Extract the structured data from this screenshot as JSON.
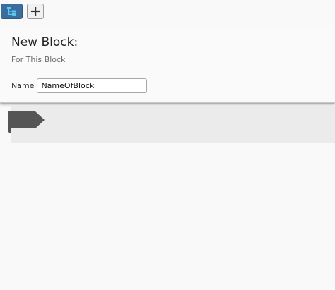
{
  "toolbar": {
    "tree_button_icon": "tree-structure-icon",
    "add_button_icon": "plus-icon",
    "tree_icon_color": "#5cc8f0",
    "tree_button_color": "#3a6e9c"
  },
  "panel": {
    "title": "New Block:",
    "subtitle": "For This Block",
    "name_label": "Name",
    "name_value": "NameOfBlock"
  },
  "canvas": {
    "block_color": "#555555",
    "area_color": "#ebebeb"
  }
}
